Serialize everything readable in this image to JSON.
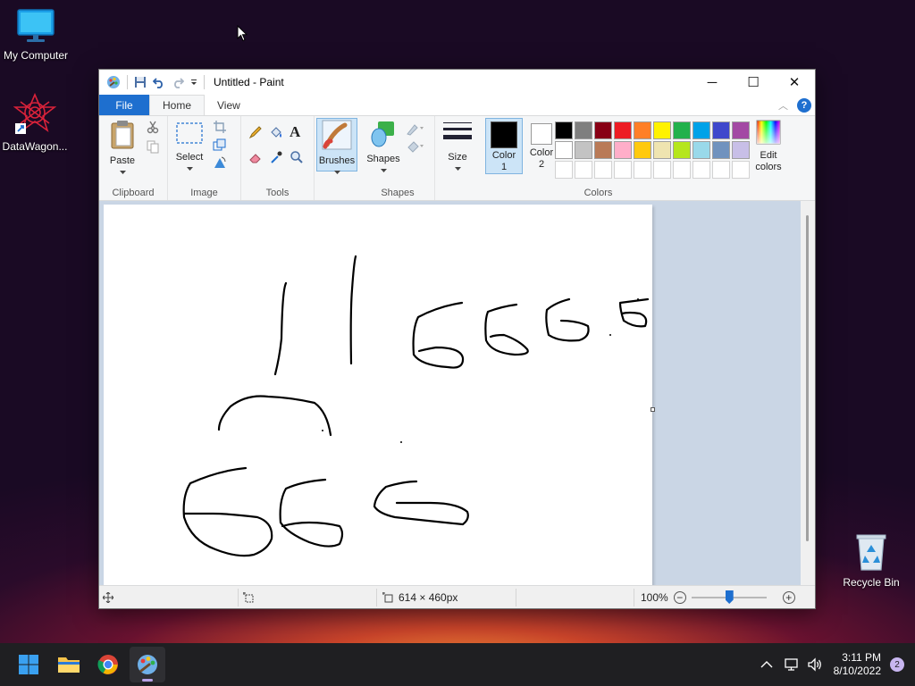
{
  "desktop": {
    "icons": [
      {
        "label": "My Computer",
        "icon": "monitor-icon"
      },
      {
        "label": "DataWagon...",
        "icon": "datawagon-shortcut-icon"
      },
      {
        "label": "Recycle Bin",
        "icon": "recycle-bin-icon"
      }
    ]
  },
  "window": {
    "title": "Untitled - Paint",
    "controls": {
      "minimize": "─",
      "maximize": "☐",
      "close": "✕"
    }
  },
  "ribbon": {
    "tabs": [
      "File",
      "Home",
      "View"
    ],
    "help": "?",
    "collapse": "︿",
    "groups": {
      "clipboard": {
        "label": "Clipboard",
        "paste": "Paste"
      },
      "image": {
        "label": "Image",
        "select": "Select"
      },
      "tools": {
        "label": "Tools",
        "text_tool": "A"
      },
      "brushes": {
        "label": "Brushes"
      },
      "shapes": {
        "label": "Shapes",
        "shapes_btn": "Shapes"
      },
      "size": {
        "label": "Size"
      },
      "colors": {
        "label": "Colors",
        "color1_label": "Color",
        "color1_num": "1",
        "color2_label": "Color",
        "color2_num": "2",
        "color1_value": "#000000",
        "color2_value": "#ffffff",
        "edit_label": "Edit",
        "edit_label2": "colors",
        "palette_row1": [
          "#000000",
          "#7f7f7f",
          "#880015",
          "#ed1c24",
          "#ff7f27",
          "#fff200",
          "#22b14c",
          "#00a2e8",
          "#3f48cc",
          "#a349a4"
        ],
        "palette_row2": [
          "#ffffff",
          "#c3c3c3",
          "#b97a57",
          "#ffaec9",
          "#ffc90e",
          "#efe4b0",
          "#b5e61d",
          "#99d9ea",
          "#7092be",
          "#c8bfe7"
        ]
      }
    }
  },
  "status": {
    "canvas_size": "614 × 460px",
    "zoom": "100%",
    "zoom_level": 0.5
  },
  "taskbar": {
    "apps": [
      "start-icon",
      "file-explorer-icon",
      "chrome-icon",
      "paint-icon"
    ],
    "time": "3:11 PM",
    "date": "8/10/2022",
    "notifications": "2"
  }
}
